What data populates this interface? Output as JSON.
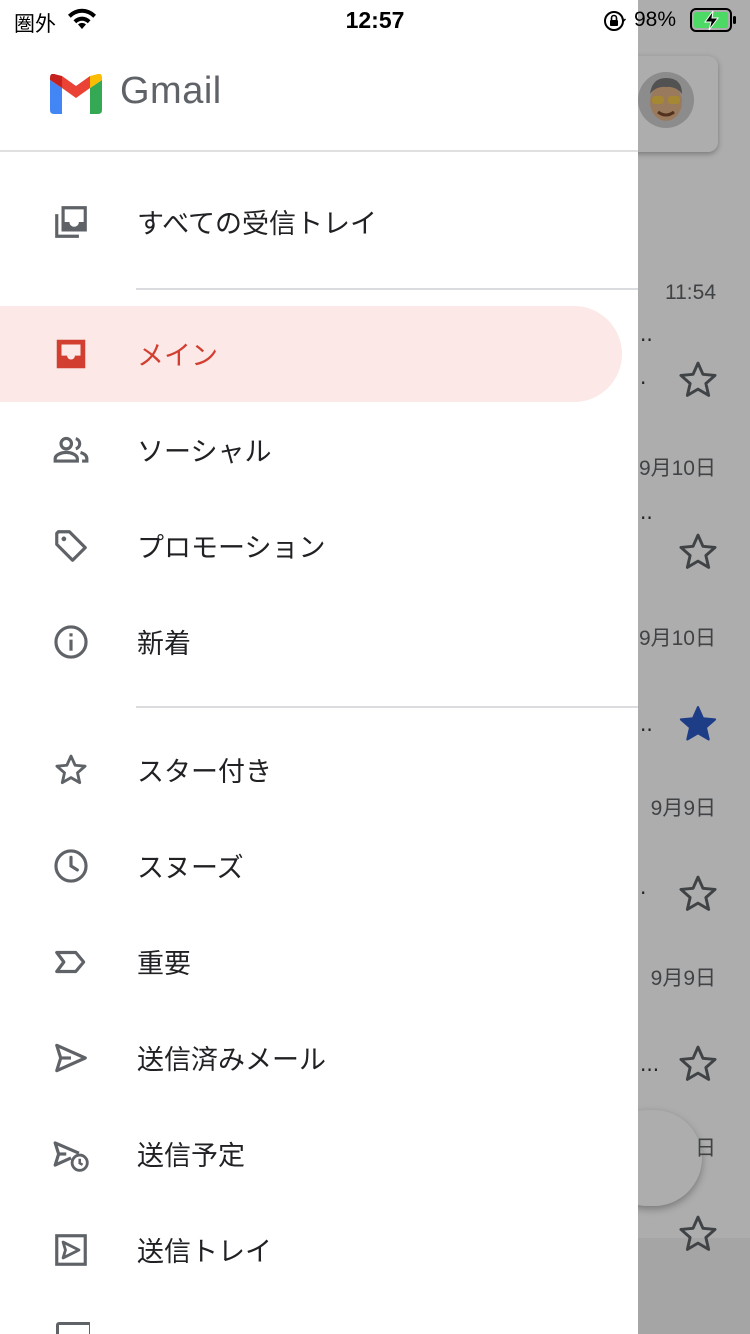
{
  "status_bar": {
    "carrier": "圏外",
    "time": "12:57",
    "battery_percent": "98%"
  },
  "drawer": {
    "app_name": "Gmail",
    "items": [
      {
        "label": "すべての受信トレイ",
        "icon": "all-inboxes-icon",
        "active": false
      },
      {
        "label": "メイン",
        "icon": "inbox-icon",
        "active": true
      },
      {
        "label": "ソーシャル",
        "icon": "people-icon",
        "active": false
      },
      {
        "label": "プロモーション",
        "icon": "tag-icon",
        "active": false
      },
      {
        "label": "新着",
        "icon": "info-icon",
        "active": false
      },
      {
        "label": "スター付き",
        "icon": "star-outline-icon",
        "active": false
      },
      {
        "label": "スヌーズ",
        "icon": "clock-icon",
        "active": false
      },
      {
        "label": "重要",
        "icon": "important-icon",
        "active": false
      },
      {
        "label": "送信済みメール",
        "icon": "send-icon",
        "active": false
      },
      {
        "label": "送信予定",
        "icon": "scheduled-send-icon",
        "active": false
      },
      {
        "label": "送信トレイ",
        "icon": "outbox-icon",
        "active": false
      }
    ]
  },
  "background_inbox": {
    "dates": [
      "11:54",
      "9月10日",
      "9月10日",
      "9月9日",
      "9月9日",
      "日"
    ],
    "stars": [
      {
        "starred": false
      },
      {
        "starred": false
      },
      {
        "starred": true
      },
      {
        "starred": false
      },
      {
        "starred": false
      },
      {
        "starred": false
      }
    ]
  },
  "colors": {
    "accent_red": "#d23f31",
    "active_bg": "#fbe8e7",
    "star_blue": "#2c5bc7",
    "icon_gray": "#5f6368"
  }
}
